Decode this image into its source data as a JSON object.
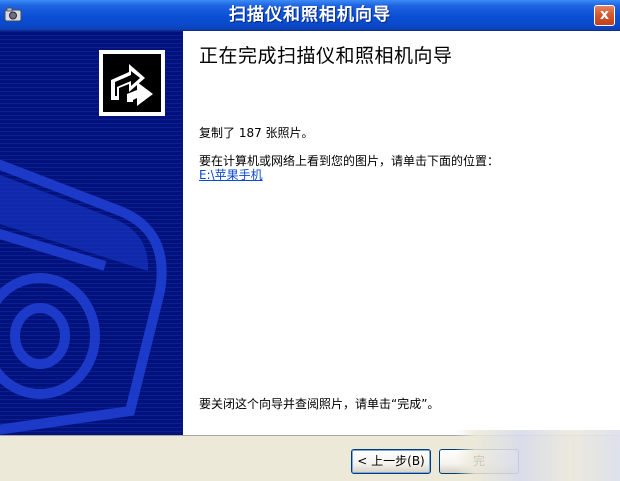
{
  "window": {
    "title": "扫描仪和照相机向导",
    "close_label": "x"
  },
  "main": {
    "heading": "正在完成扫描仪和照相机向导",
    "copied_text": "复制了 187 张照片。",
    "view_instruction": "要在计算机或网络上看到您的图片，请单击下面的位置：",
    "location_link": "E:\\苹果手机",
    "close_instruction": "要关闭这个向导并查阅照片，请单击“完成”。"
  },
  "buttons": {
    "back_label": "< 上一步(B)",
    "finish_label": "完"
  },
  "colors": {
    "titlebar": "#0b4fd6",
    "banner": "#02127a",
    "link": "#0a4ad0",
    "button_bar": "#ece9d8"
  },
  "icons": {
    "title": "scanner-camera-icon",
    "banner": "wizard-arrow-icon",
    "banner_art": "camera-outline-art"
  }
}
